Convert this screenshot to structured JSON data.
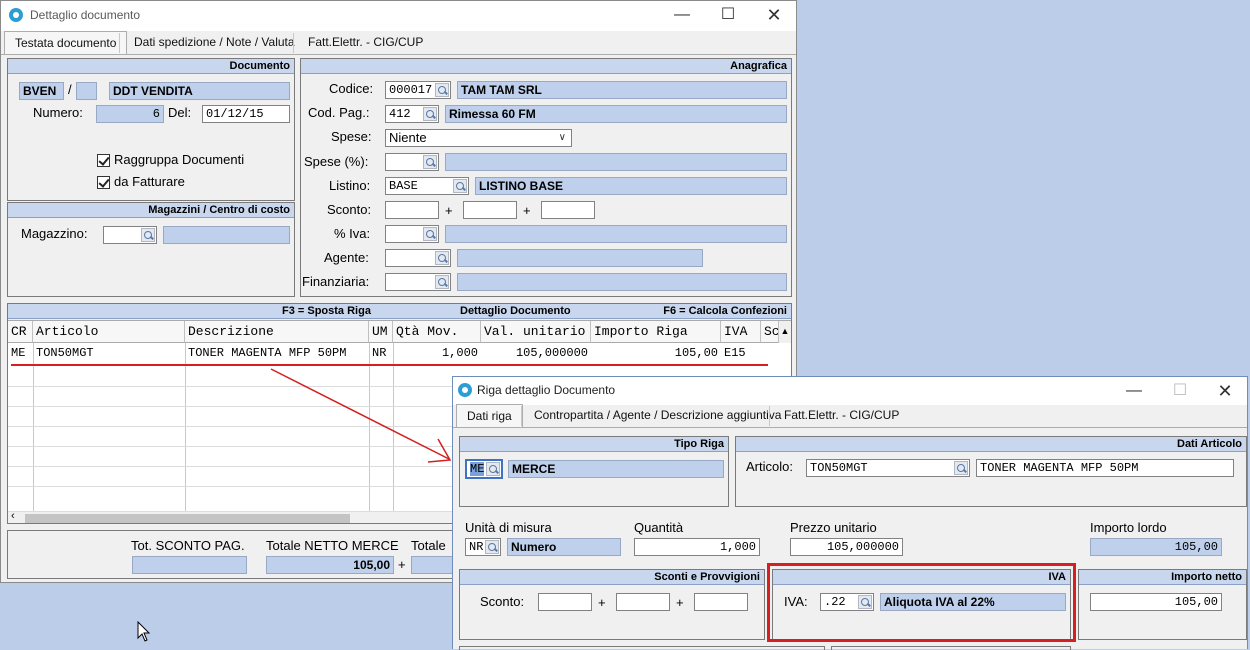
{
  "main_window": {
    "title": "Dettaglio documento",
    "tabs": [
      "Testata documento",
      "Dati spedizione / Note / Valuta",
      "Fatt.Elettr. - CIG/CUP"
    ],
    "documento": {
      "header": "Documento",
      "tipo": "BVEN",
      "sep": "/",
      "serie": "",
      "descr": "DDT VENDITA",
      "numero_label": "Numero:",
      "numero": "6",
      "del_label": "Del:",
      "data": "01/12/15",
      "check1": "Raggruppa Documenti",
      "check2": "da Fatturare"
    },
    "magazzini": {
      "header": "Magazzini / Centro di costo",
      "magazzino_label": "Magazzino:"
    },
    "anagrafica": {
      "header": "Anagrafica",
      "codice_label": "Codice:",
      "codice": "000017",
      "cliente": "TAM TAM SRL",
      "codpag_label": "Cod. Pag.:",
      "codpag": "412",
      "codpag_descr": "Rimessa 60 FM",
      "spese_label": "Spese:",
      "spese": "Niente",
      "spese_pct_label": "Spese (%):",
      "listino_label": "Listino:",
      "listino": "BASE",
      "listino_descr": "LISTINO BASE",
      "sconto_label": "Sconto:",
      "plus": "+",
      "iva_label": "% Iva:",
      "agente_label": "Agente:",
      "finanziaria_label": "Finanziaria:"
    },
    "dettaglio": {
      "hint_left": "F3 = Sposta Riga",
      "header": "Dettaglio Documento",
      "hint_right": "F6 = Calcola Confezioni",
      "columns": [
        "CR",
        "Articolo",
        "Descrizione",
        "UM",
        "Qtà Mov.",
        "Val. unitario",
        "Importo Riga",
        "IVA",
        "Sc"
      ],
      "row": [
        "ME",
        "TON50MGT",
        "TONER MAGENTA MFP 50PM",
        "NR",
        "1,000",
        "105,000000",
        "105,00",
        "E15"
      ]
    },
    "totali": {
      "sconto_pag_label": "Tot. SCONTO PAG.",
      "netto_merce_label": "Totale NETTO MERCE",
      "netto_merce": "105,00",
      "plus": "+",
      "totale_label": "Totale"
    }
  },
  "dialog": {
    "title": "Riga dettaglio Documento",
    "tabs": [
      "Dati riga",
      "Contropartita / Agente / Descrizione aggiuntiva",
      "Fatt.Elettr. - CIG/CUP"
    ],
    "tipo_riga": {
      "header": "Tipo Riga",
      "code": "ME",
      "descr": "MERCE"
    },
    "dati_articolo": {
      "header": "Dati Articolo",
      "articolo_label": "Articolo:",
      "codice": "TON50MGT",
      "descr": "TONER MAGENTA MFP 50PM"
    },
    "um_label": "Unità di misura",
    "um_code": "NR",
    "um_descr": "Numero",
    "quantita_label": "Quantità",
    "quantita": "1,000",
    "prezzo_label": "Prezzo unitario",
    "prezzo": "105,000000",
    "lordo_label": "Importo lordo",
    "lordo": "105,00",
    "sconti": {
      "header": "Sconti e Provvigioni",
      "sconto_label": "Sconto:",
      "plus": "+"
    },
    "iva": {
      "header": "IVA",
      "iva_label": "IVA:",
      "code": ".22",
      "descr": "Aliquota IVA al 22%"
    },
    "netto": {
      "header": "Importo netto",
      "value": "105,00"
    }
  },
  "colors": {
    "annotation": "#d42020",
    "readonly_field": "#bfd0ec",
    "desktop": "#bccde9"
  }
}
